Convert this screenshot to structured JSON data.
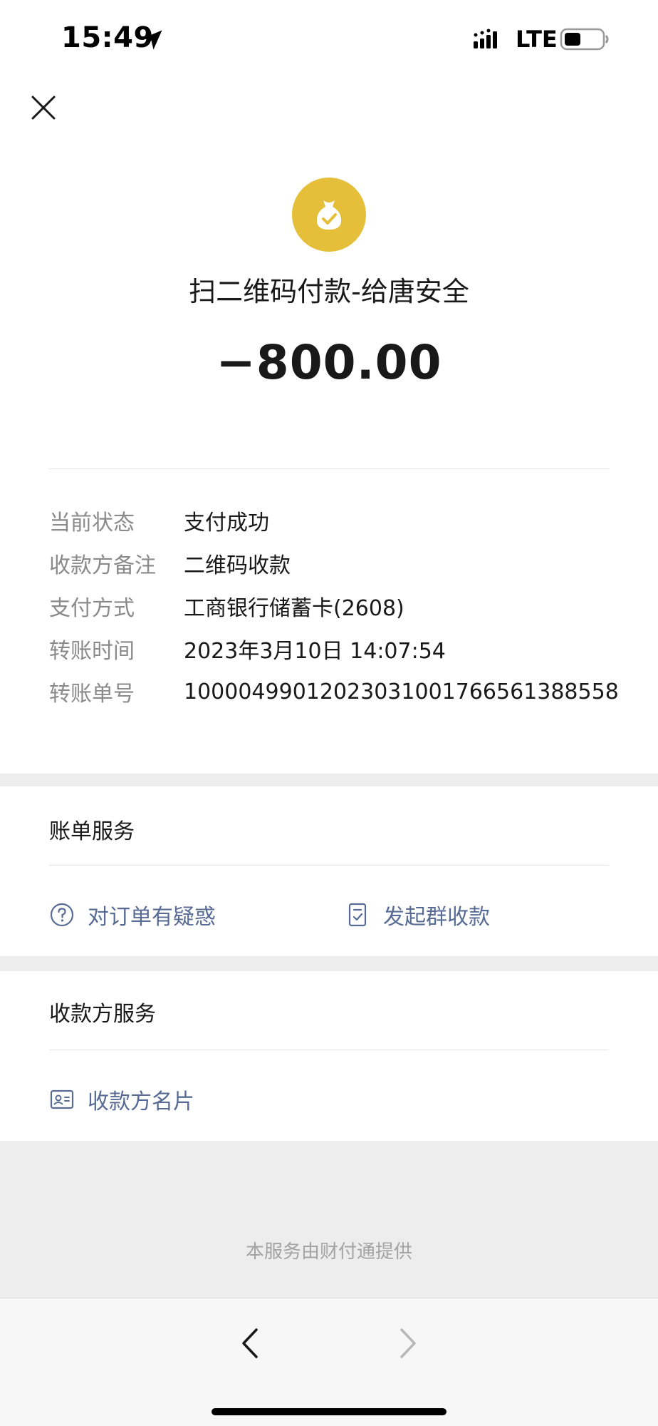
{
  "status_bar": {
    "time": "15:49",
    "network": "LTE"
  },
  "icons": {
    "close": "close-icon",
    "merchant": "money-bag-check-icon",
    "question": "question-circle-icon",
    "group_receipt": "document-check-icon",
    "card": "business-card-icon",
    "back": "chevron-left-icon",
    "forward": "chevron-right-icon"
  },
  "colors": {
    "accent_gold": "#e6bf3a",
    "link_blue": "#576b95",
    "label_gray": "#8a8a8a"
  },
  "header": {
    "title": "扫二维码付款-给唐安全",
    "amount": "−800.00"
  },
  "details": [
    {
      "label": "当前状态",
      "value": "支付成功"
    },
    {
      "label": "收款方备注",
      "value": "二维码收款"
    },
    {
      "label": "支付方式",
      "value": "工商银行储蓄卡(2608)"
    },
    {
      "label": "转账时间",
      "value": "2023年3月10日 14:07:54"
    },
    {
      "label": "转账单号",
      "value": "100004990120230310017665613885​58"
    }
  ],
  "bill_service": {
    "title": "账单服务",
    "question_label": "对订单有疑惑",
    "group_receipt_label": "发起群收款"
  },
  "payee_service": {
    "title": "收款方服务",
    "card_label": "收款方名片"
  },
  "footer": {
    "note": "本服务由财付通提供"
  }
}
